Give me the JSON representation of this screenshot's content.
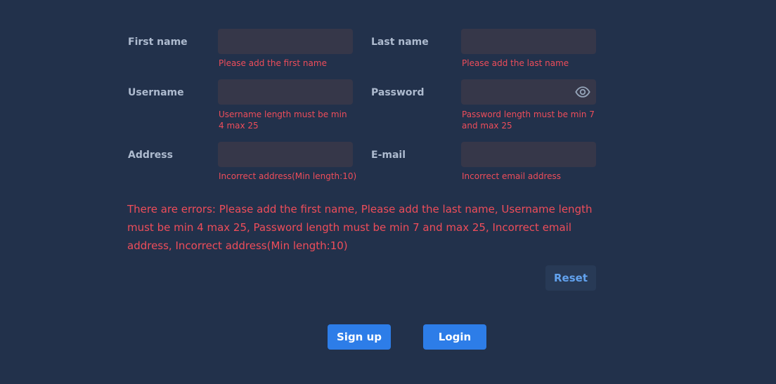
{
  "form": {
    "first_name": {
      "label": "First name",
      "value": "",
      "error": "Please add the first name"
    },
    "last_name": {
      "label": "Last name",
      "value": "",
      "error": "Please add the last name"
    },
    "username": {
      "label": "Username",
      "value": "",
      "error": "Username length must be min 4 max 25"
    },
    "password": {
      "label": "Password",
      "value": "",
      "error": "Password length must be min 7 and max 25",
      "toggle_icon": "eye-icon"
    },
    "address": {
      "label": "Address",
      "value": "",
      "error": "Incorrect address(Min length:10)"
    },
    "email": {
      "label": "E-mail",
      "value": "",
      "error": "Incorrect email address"
    }
  },
  "error_summary": "There are errors: Please add the first name, Please add the last name, Username length must be min 4 max 25, Password length must be min 7 and max 25, Incorrect email address, Incorrect address(Min length:10)",
  "buttons": {
    "reset": "Reset",
    "signup": "Sign up",
    "login": "Login"
  },
  "colors": {
    "background": "#22314b",
    "field_background": "#363749",
    "error": "#ee4d5a",
    "primary": "#2d7de8",
    "reset_text": "#62a2ee"
  }
}
